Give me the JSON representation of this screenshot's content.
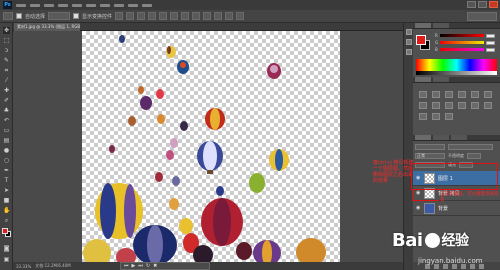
{
  "app": {
    "logo_text": "Ps"
  },
  "options_bar": {
    "mode_label": "自动选择",
    "checkbox_label": "显示变换控件"
  },
  "document": {
    "tab_title": "素材1.jpg @ 33.3% (图层 1, RGB/8)"
  },
  "status": {
    "zoom": "33.33%",
    "doc_info": "文档:12.2M/6.40M"
  },
  "layers": {
    "blend_mode": "正常",
    "opacity_label": "不透明度",
    "fill_label": "填充",
    "items": [
      {
        "name": "图层 1",
        "selected": true,
        "thumb": "transparent"
      },
      {
        "name": "背景 拷贝",
        "selected": false,
        "thumb": "transparent"
      },
      {
        "name": "背景",
        "selected": false,
        "thumb": "blue"
      }
    ]
  },
  "annotations": {
    "note1": "按ctrl+j 拷贝新建一个图层图，然后删除图层之后出来的效果",
    "note2": "这是新图层，可以接着添加背景"
  },
  "watermark": {
    "brand": "Bai",
    "brand2": "经验",
    "url": "jingyan.baidu.com"
  },
  "colors": {
    "foreground": "#e21a1a",
    "background": "#000000",
    "annotation": "#ff2a2a",
    "selection": "#3d6ea3"
  }
}
